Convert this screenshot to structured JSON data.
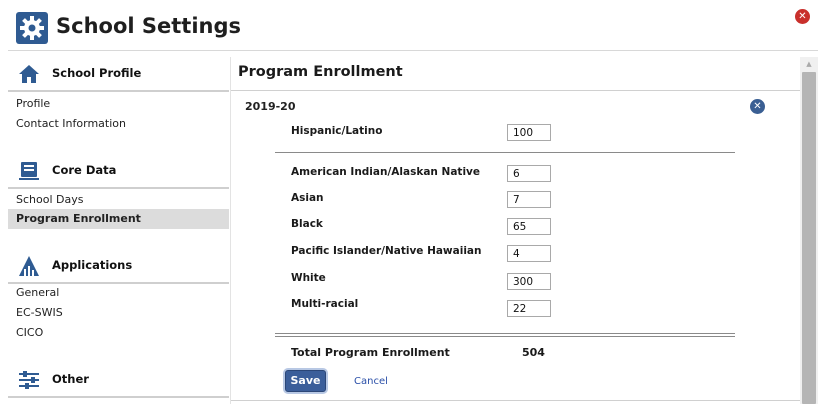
{
  "window": {
    "title": "School Settings"
  },
  "sidebar": {
    "sections": [
      {
        "label": "School Profile",
        "icon": "house-icon",
        "items": [
          "Profile",
          "Contact Information"
        ]
      },
      {
        "label": "Core Data",
        "icon": "folder-icon",
        "items": [
          "School Days",
          "Program Enrollment"
        ]
      },
      {
        "label": "Applications",
        "icon": "applications-icon",
        "items": [
          "General",
          "EC-SWIS",
          "CICO"
        ]
      },
      {
        "label": "Other",
        "icon": "sliders-icon",
        "items": []
      }
    ],
    "active_item": "Program Enrollment"
  },
  "main": {
    "title": "Program Enrollment",
    "year": "2019-20",
    "ethnicity": {
      "label": "Hispanic/Latino",
      "value": "100"
    },
    "race_rows": [
      {
        "label": "American Indian/Alaskan Native",
        "value": "6"
      },
      {
        "label": "Asian",
        "value": "7"
      },
      {
        "label": "Black",
        "value": "65"
      },
      {
        "label": "Pacific Islander/Native Hawaiian",
        "value": "4"
      },
      {
        "label": "White",
        "value": "300"
      },
      {
        "label": "Multi-racial",
        "value": "22"
      }
    ],
    "total_label": "Total Program Enrollment",
    "total_value": "504",
    "save_label": "Save",
    "cancel_label": "Cancel"
  },
  "colors": {
    "accent": "#3b5e9a",
    "close_button": "#c9302c",
    "link": "#2a4fa8",
    "active_nav_bg": "#dcdcdc"
  }
}
